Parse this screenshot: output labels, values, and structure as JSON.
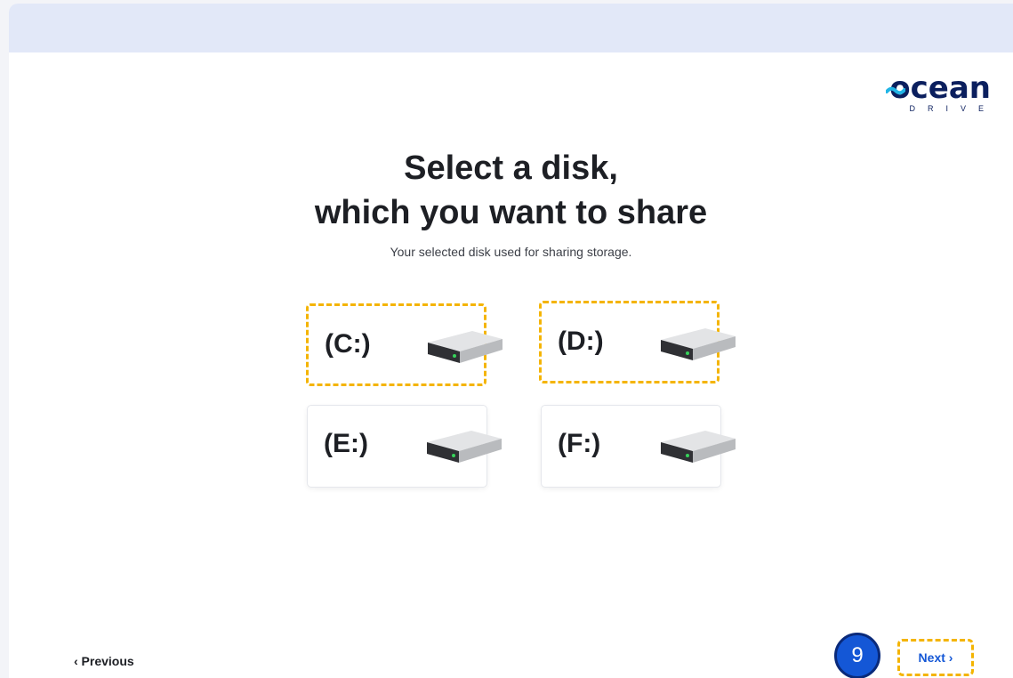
{
  "brand": {
    "name": "ocean",
    "sub": "DRIVE"
  },
  "heading": {
    "line1": "Select a disk,",
    "line2": "which you want to share"
  },
  "subtitle": "Your selected disk used for sharing storage.",
  "disks": [
    {
      "label": "(C:)",
      "selected": true,
      "icon": "hard-drive-icon"
    },
    {
      "label": "(D:)",
      "selected": true,
      "icon": "hard-drive-icon"
    },
    {
      "label": "(E:)",
      "selected": false,
      "icon": "hard-drive-icon"
    },
    {
      "label": "(F:)",
      "selected": false,
      "icon": "hard-drive-icon"
    }
  ],
  "nav": {
    "previous": "‹ Previous",
    "next": "Next ›"
  },
  "step_badge": "9",
  "colors": {
    "accent": "#1457d6",
    "highlight": "#f4b400",
    "topbar": "#e2e8f8",
    "brand": "#0b1f5e"
  }
}
